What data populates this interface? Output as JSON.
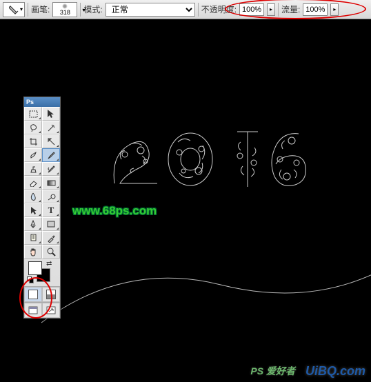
{
  "options_bar": {
    "brush_label": "画笔:",
    "brush_size": "318",
    "mode_label": "模式:",
    "mode_value": "正常",
    "opacity_label": "不透明度:",
    "opacity_value": "100%",
    "flow_label": "流量:",
    "flow_value": "100%"
  },
  "toolbox": {
    "header": "Ps",
    "fg_color": "#ffffff",
    "bg_color": "#000000"
  },
  "canvas": {
    "text_content": "2016",
    "watermark": "www.68ps.com"
  },
  "footer": {
    "ps_text": "PS 爱好者",
    "brand": "UiBQ.com"
  },
  "highlight_color": "#d00000"
}
